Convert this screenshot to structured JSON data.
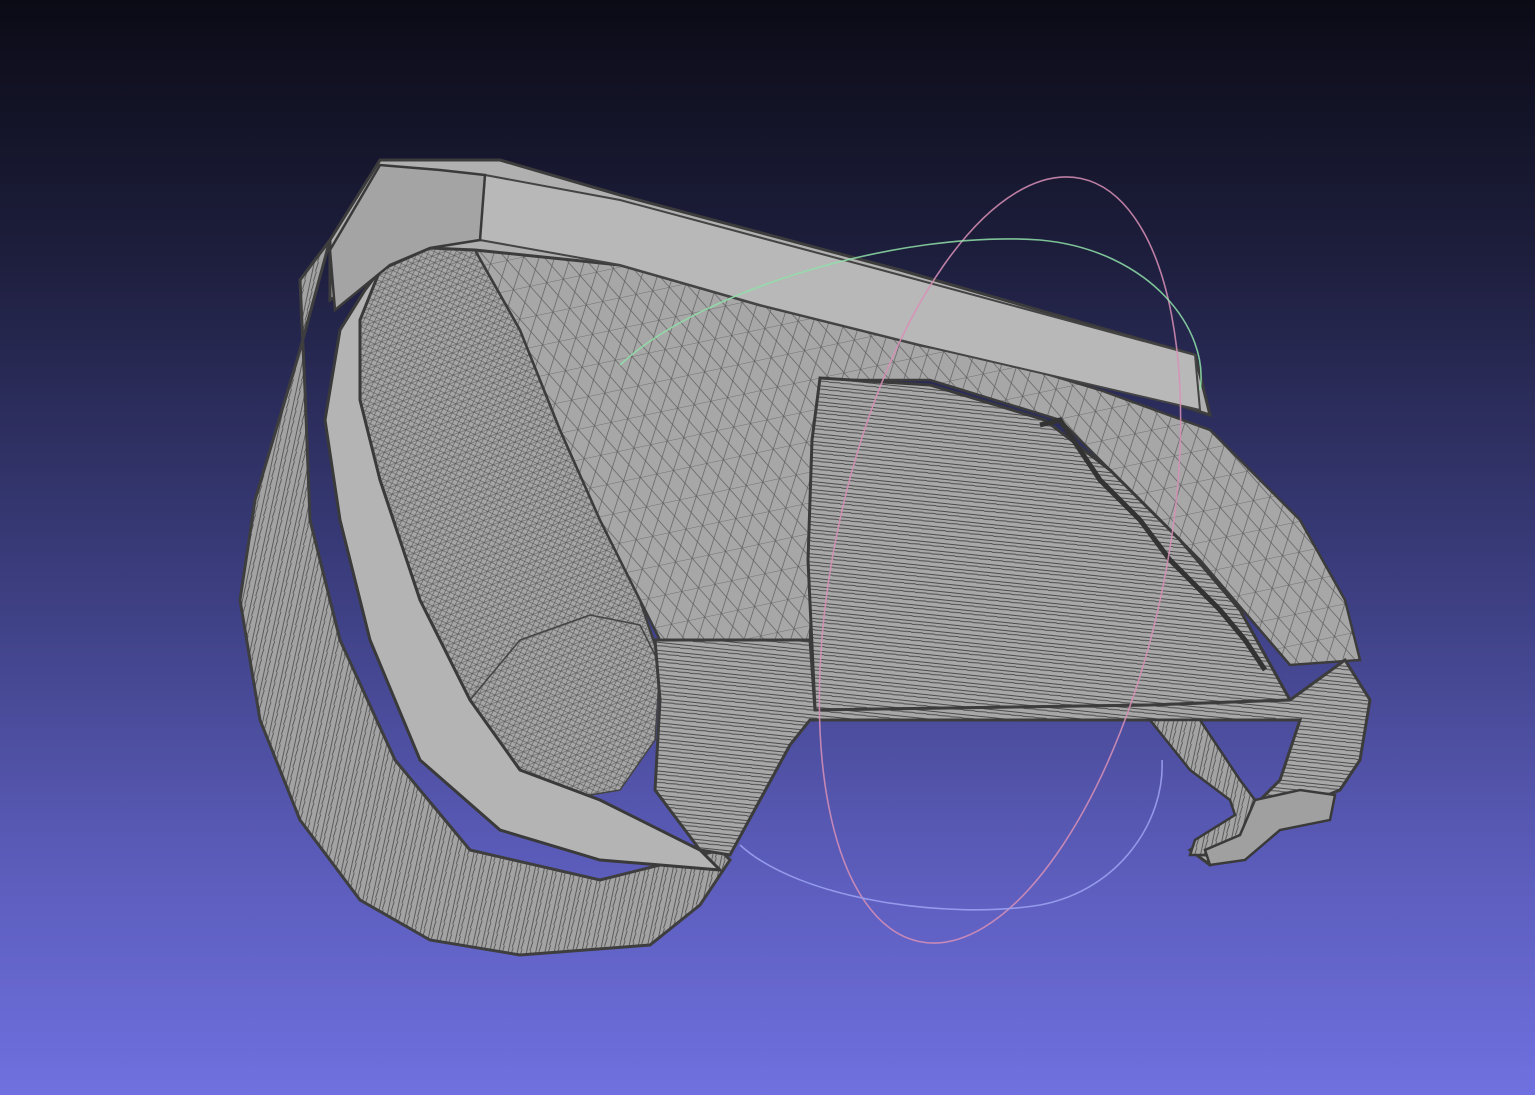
{
  "viewer": {
    "title": "",
    "background_top": "#0b0b16",
    "background_bottom": "#7070e0"
  },
  "model": {
    "render_mode": "flat-lines",
    "fill_color": "#a9a9a9",
    "edge_color": "#3c3c3c"
  },
  "trackball": {
    "visible": true,
    "ring_colors": [
      "#d88fb6",
      "#8fe0a8",
      "#9aa0f0"
    ]
  }
}
